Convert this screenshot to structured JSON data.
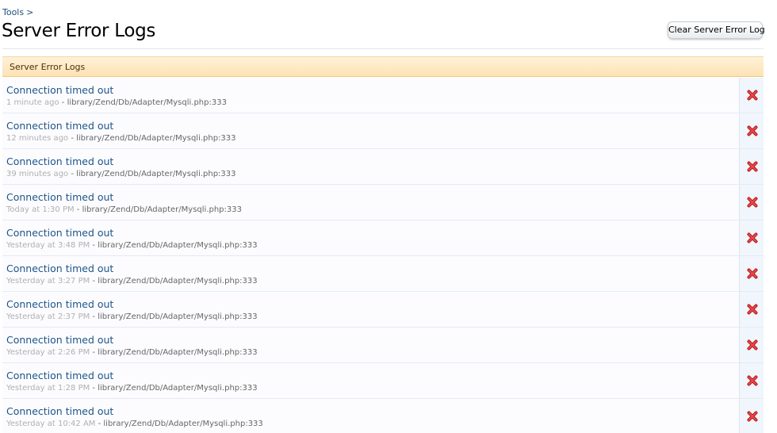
{
  "breadcrumb": {
    "items": [
      "Tools"
    ],
    "separator": ">"
  },
  "page": {
    "title": "Server Error Logs"
  },
  "toolbar": {
    "clear_label": "Clear Server Error Log"
  },
  "section": {
    "header": "Server Error Logs"
  },
  "logs": [
    {
      "title": "Connection timed out",
      "time": "1 minute ago",
      "separator": " - ",
      "file": "library/Zend/Db/Adapter/Mysqli.php:333"
    },
    {
      "title": "Connection timed out",
      "time": "12 minutes ago",
      "separator": " - ",
      "file": "library/Zend/Db/Adapter/Mysqli.php:333"
    },
    {
      "title": "Connection timed out",
      "time": "39 minutes ago",
      "separator": " - ",
      "file": "library/Zend/Db/Adapter/Mysqli.php:333"
    },
    {
      "title": "Connection timed out",
      "time": "Today at 1:30 PM",
      "separator": " - ",
      "file": "library/Zend/Db/Adapter/Mysqli.php:333"
    },
    {
      "title": "Connection timed out",
      "time": "Yesterday at 3:48 PM",
      "separator": " - ",
      "file": "library/Zend/Db/Adapter/Mysqli.php:333"
    },
    {
      "title": "Connection timed out",
      "time": "Yesterday at 3:27 PM",
      "separator": " - ",
      "file": "library/Zend/Db/Adapter/Mysqli.php:333"
    },
    {
      "title": "Connection timed out",
      "time": "Yesterday at 2:37 PM",
      "separator": " - ",
      "file": "library/Zend/Db/Adapter/Mysqli.php:333"
    },
    {
      "title": "Connection timed out",
      "time": "Yesterday at 2:26 PM",
      "separator": " - ",
      "file": "library/Zend/Db/Adapter/Mysqli.php:333"
    },
    {
      "title": "Connection timed out",
      "time": "Yesterday at 1:28 PM",
      "separator": " - ",
      "file": "library/Zend/Db/Adapter/Mysqli.php:333"
    },
    {
      "title": "Connection timed out",
      "time": "Yesterday at 10:42 AM",
      "separator": " - ",
      "file": "library/Zend/Db/Adapter/Mysqli.php:333"
    }
  ],
  "icons": {
    "delete": "close-icon"
  },
  "colors": {
    "link": "#1d5588",
    "header_bg": "#fde3b4",
    "delete_red": "#d8262a",
    "muted_time": "#b0b0b0"
  }
}
